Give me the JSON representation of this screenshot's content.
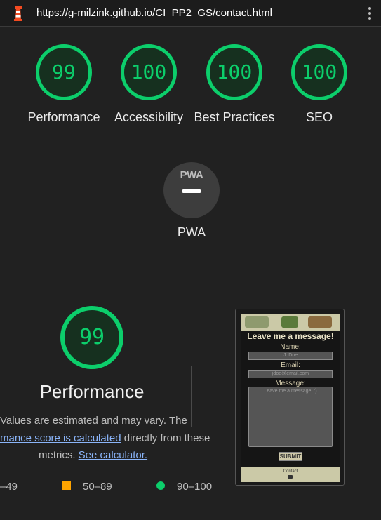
{
  "browser": {
    "url": "https://g-milzink.github.io/CI_PP2_GS/contact.html",
    "app_icon": "lighthouse-icon",
    "menu_icon": "more-vert-icon"
  },
  "categories": [
    {
      "score": "99",
      "label": "Performance"
    },
    {
      "score": "100",
      "label": "Accessibility"
    },
    {
      "score": "100",
      "label": "Best Practices"
    },
    {
      "score": "100",
      "label": "SEO"
    }
  ],
  "pwa": {
    "badge": "PWA",
    "label": "PWA"
  },
  "performance": {
    "score": "99",
    "title": "Performance",
    "desc_line1": "Values are estimated and may vary. The",
    "desc_link1": "mance score is calculated",
    "desc_line2_rest": " directly from these",
    "desc_line3_start": "metrics. ",
    "desc_link2": "See calculator."
  },
  "legend": {
    "low": "–49",
    "mid": "50–89",
    "high": "90–100"
  },
  "screenshot": {
    "title": "Leave me a message!",
    "name_label": "Name:",
    "name_placeholder": "J. Doe",
    "email_label": "Email:",
    "email_placeholder": "jdoe@email.com",
    "message_label": "Message:",
    "message_placeholder": "Leave me a message! :)",
    "submit": "SUBMIT",
    "footer": "Contact"
  },
  "colors": {
    "pass": "#0cce6b",
    "average": "#ffa400",
    "link": "#8ab4f8",
    "background": "#212121"
  }
}
